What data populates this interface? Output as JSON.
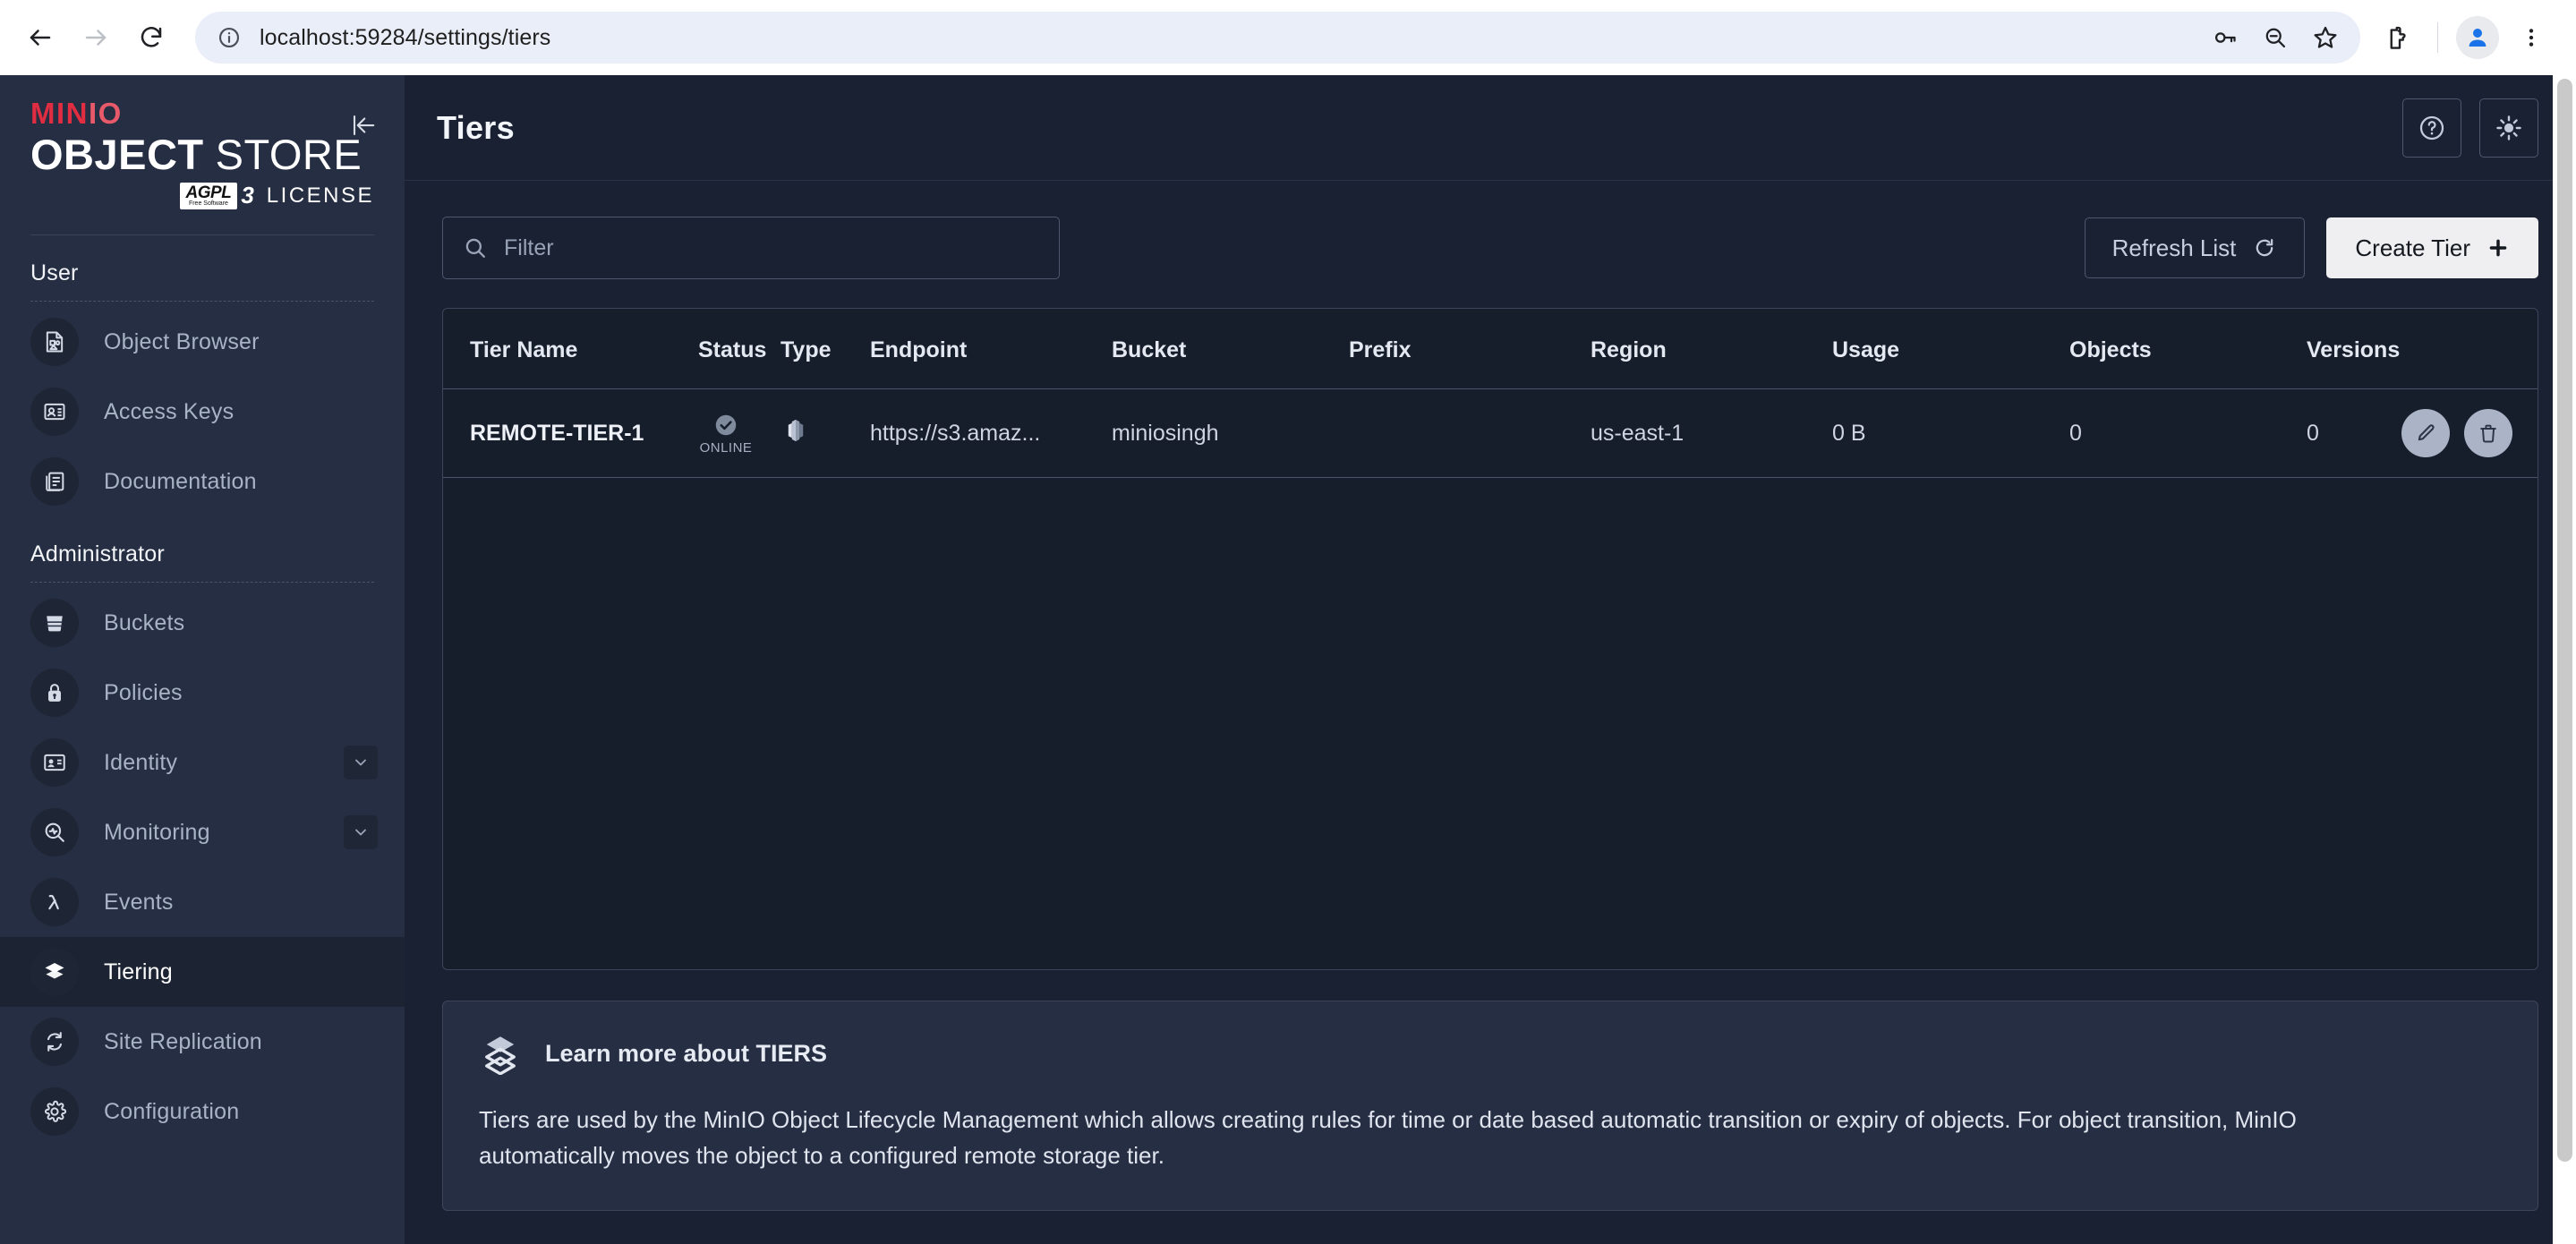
{
  "browser": {
    "url": "localhost:59284/settings/tiers",
    "back_icon": "back-arrow-icon",
    "forward_icon": "forward-arrow-icon",
    "reload_icon": "reload-icon",
    "site_info_icon": "site-info-icon",
    "password_icon": "password-key-icon",
    "zoom_out_icon": "zoom-out-icon",
    "bookmark_icon": "bookmark-star-icon",
    "extensions_icon": "extensions-puzzle-icon",
    "profile_icon": "profile-avatar-icon",
    "menu_icon": "three-dot-menu-icon"
  },
  "sidebar": {
    "logo": {
      "brand_prefix": "MIN",
      "brand_suffix": "IO",
      "title_bold": "OBJECT",
      "title_regular": "STORE",
      "badge_text": "AGPL",
      "badge_sub": "Free Software",
      "badge_version": "3",
      "license_word": "LICENSE",
      "brand_color": "#e02d42"
    },
    "collapse_icon": "collapse-sidebar-icon",
    "groups": [
      {
        "title": "User",
        "items": [
          {
            "label": "Object Browser",
            "icon": "object-browser-icon",
            "active": false,
            "expandable": false
          },
          {
            "label": "Access Keys",
            "icon": "access-keys-icon",
            "active": false,
            "expandable": false
          },
          {
            "label": "Documentation",
            "icon": "documentation-icon",
            "active": false,
            "expandable": false
          }
        ]
      },
      {
        "title": "Administrator",
        "items": [
          {
            "label": "Buckets",
            "icon": "buckets-icon",
            "active": false,
            "expandable": false
          },
          {
            "label": "Policies",
            "icon": "policies-lock-icon",
            "active": false,
            "expandable": false
          },
          {
            "label": "Identity",
            "icon": "identity-card-icon",
            "active": false,
            "expandable": true
          },
          {
            "label": "Monitoring",
            "icon": "monitoring-icon",
            "active": false,
            "expandable": true
          },
          {
            "label": "Events",
            "icon": "events-lambda-icon",
            "active": false,
            "expandable": false
          },
          {
            "label": "Tiering",
            "icon": "tiering-layers-icon",
            "active": true,
            "expandable": false
          },
          {
            "label": "Site Replication",
            "icon": "site-replication-icon",
            "active": false,
            "expandable": false
          },
          {
            "label": "Configuration",
            "icon": "configuration-gear-icon",
            "active": false,
            "expandable": false
          }
        ]
      }
    ]
  },
  "header": {
    "title": "Tiers",
    "help_icon": "help-question-icon",
    "theme_icon": "light-mode-sun-icon"
  },
  "toolbar": {
    "filter_placeholder": "Filter",
    "filter_value": "",
    "search_icon": "search-icon",
    "refresh_label": "Refresh List",
    "refresh_icon": "refresh-icon",
    "create_label": "Create Tier",
    "create_icon": "plus-icon"
  },
  "table": {
    "columns": [
      "Tier Name",
      "Status",
      "Type",
      "Endpoint",
      "Bucket",
      "Prefix",
      "Region",
      "Usage",
      "Objects",
      "Versions"
    ],
    "rows": [
      {
        "tier_name": "REMOTE-TIER-1",
        "status": "ONLINE",
        "status_icon": "online-check-icon",
        "type_icon": "s3-tier-type-icon",
        "endpoint": "https://s3.amaz...",
        "bucket": "miniosingh",
        "prefix": "",
        "region": "us-east-1",
        "usage": "0 B",
        "objects": "0",
        "versions": "0",
        "edit_icon": "edit-pencil-icon",
        "delete_icon": "delete-trash-icon"
      }
    ]
  },
  "learn_panel": {
    "icon": "tiering-layers-icon",
    "title": "Learn more about TIERS",
    "body": "Tiers are used by the MinIO Object Lifecycle Management which allows creating rules for time or date based automatic transition or expiry of objects. For object transition, MinIO automatically moves the object to a configured remote storage tier."
  }
}
